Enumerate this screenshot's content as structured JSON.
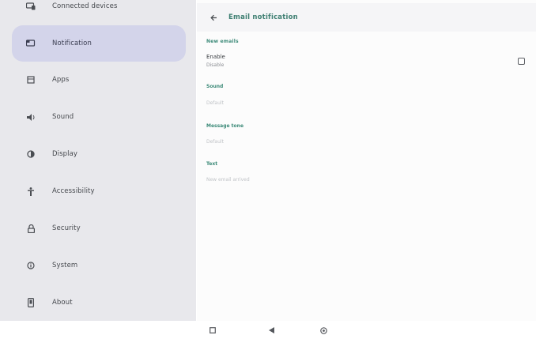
{
  "sidebar": {
    "items": [
      {
        "label": "Connected devices",
        "icon": "devices-icon"
      },
      {
        "label": "Notification",
        "icon": "notifications-icon",
        "selected": true
      },
      {
        "label": "Apps",
        "icon": "apps-icon"
      },
      {
        "label": "Sound",
        "icon": "volume-icon"
      },
      {
        "label": "Display",
        "icon": "brightness-icon"
      },
      {
        "label": "Accessibility",
        "icon": "accessibility-icon"
      },
      {
        "label": "Security",
        "icon": "lock-icon"
      },
      {
        "label": "System",
        "icon": "info-icon"
      },
      {
        "label": "About",
        "icon": "phone-icon"
      }
    ]
  },
  "header": {
    "title": "Email notification"
  },
  "preferences": {
    "section_label": "New emails",
    "enable_title": "Enable",
    "enable_summary": "Disable",
    "sound_title": "Sound",
    "sound_value": "Default",
    "message_tone_title": "Message tone",
    "message_tone_value": "Default",
    "text_title": "Text",
    "text_value": "New email arrived"
  },
  "colors": {
    "accent": "#3c8a78",
    "sidebar_bg": "#e8e8ec",
    "selected_bg": "#d3d4ea"
  }
}
